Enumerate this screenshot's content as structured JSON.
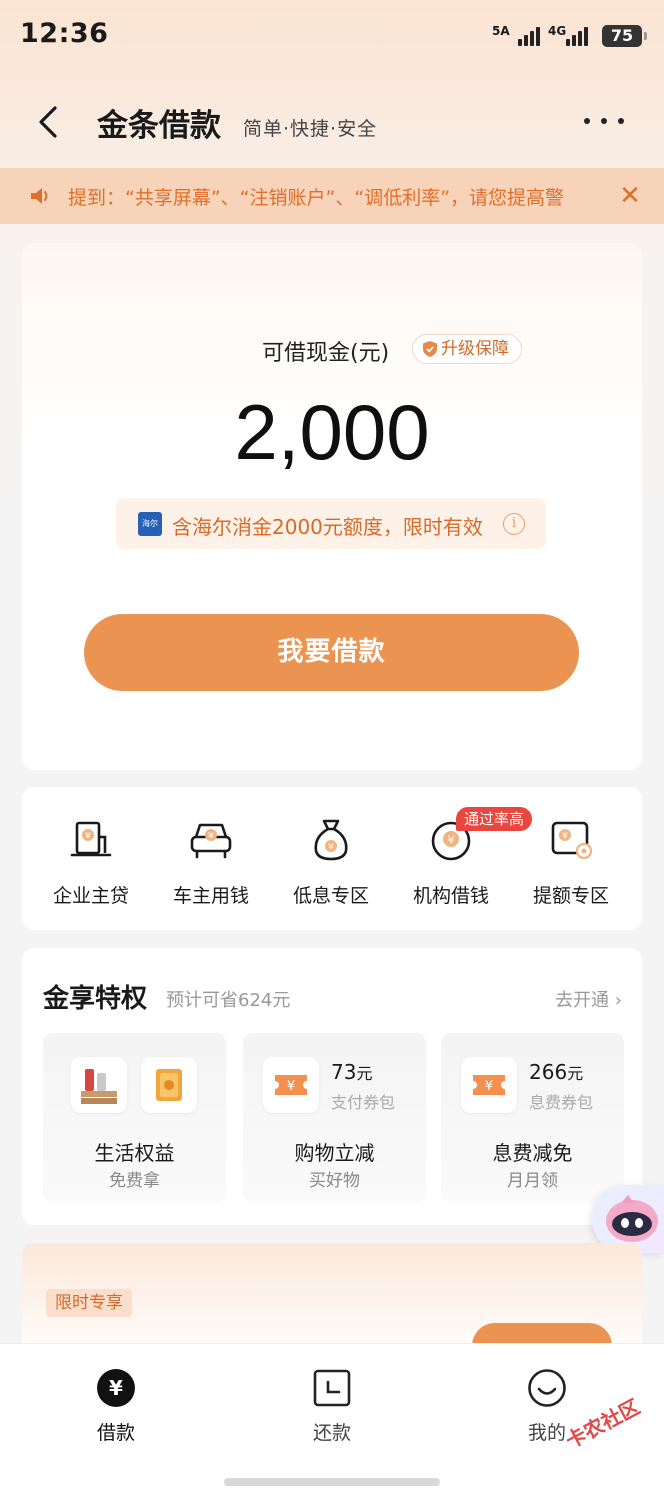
{
  "status": {
    "time": "12:36",
    "sim1": "5A",
    "sim2": "4G",
    "battery": "75"
  },
  "nav": {
    "title": "金条借款",
    "subtitle": "简单·快捷·安全"
  },
  "notice": {
    "text": "提到：“共享屏幕”、“注销账户”、“调低利率”，请您提高警"
  },
  "main": {
    "amount_label": "可借现金(元)",
    "upgrade_label": "升级保障",
    "amount": "2,000",
    "promo_text": "含海尔消金2000元额度，限时有效",
    "borrow_button": "我要借款"
  },
  "quick": {
    "items": [
      {
        "label": "企业主贷",
        "icon": "enterprise-loan-icon"
      },
      {
        "label": "车主用钱",
        "icon": "car-icon"
      },
      {
        "label": "低息专区",
        "icon": "money-bag-icon"
      },
      {
        "label": "机构借钱",
        "icon": "institution-icon"
      },
      {
        "label": "提额专区",
        "icon": "raise-limit-icon"
      }
    ],
    "hot_badge": "通过率高"
  },
  "privilege": {
    "title": "金享特权",
    "subtitle": "预计可省624元",
    "link": "去开通",
    "tiles": [
      {
        "title": "生活权益",
        "sub": "免费拿"
      },
      {
        "title": "购物立减",
        "sub": "买好物",
        "value": "73",
        "unit": "元",
        "type": "支付券包"
      },
      {
        "title": "息费减免",
        "sub": "月月领",
        "value": "266",
        "unit": "元",
        "type": "息费券包"
      }
    ]
  },
  "promo": {
    "tag": "限时专享"
  },
  "tabbar": {
    "items": [
      {
        "label": "借款",
        "icon": "yuan-icon",
        "active": true
      },
      {
        "label": "还款",
        "icon": "repay-icon",
        "active": false
      },
      {
        "label": "我的",
        "icon": "smile-icon",
        "active": false
      }
    ]
  },
  "watermark": "卡农社区",
  "colors": {
    "accent": "#eb9452",
    "accent_text": "#d76a28",
    "notice_bg": "#f6d3b9",
    "hot_badge": "#e8463f"
  }
}
